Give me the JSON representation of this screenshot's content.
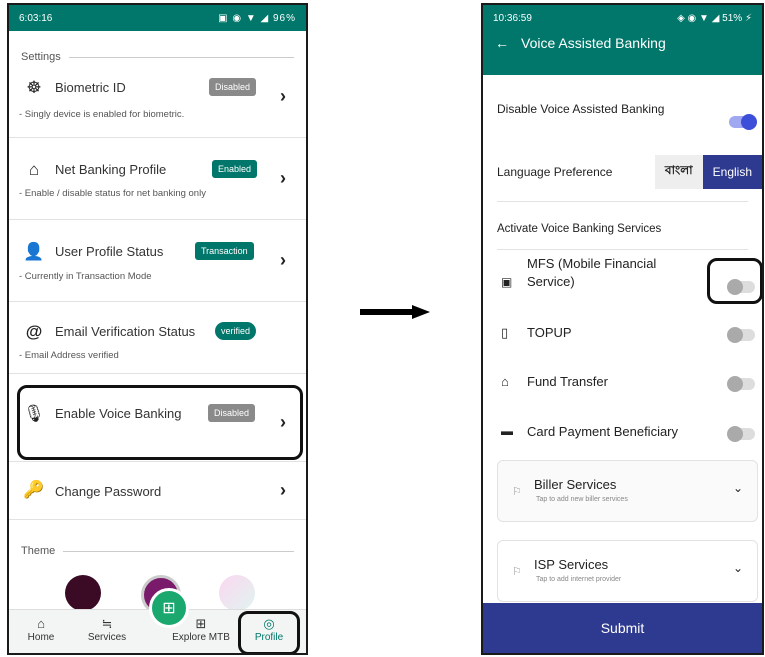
{
  "left_phone": {
    "status_time": "6:03:16",
    "status_icons": "▣ ◉ ▼ ◢ 96%",
    "settings_label": "Settings",
    "items": [
      {
        "title": "Biometric ID",
        "badge": "Disabled",
        "sub": "- Singly device is enabled for biometric."
      },
      {
        "title": "Net Banking Profile",
        "badge": "Enabled",
        "sub": "- Enable / disable status for net banking only"
      },
      {
        "title": "User Profile Status",
        "badge": "Transaction",
        "sub": "- Currently in Transaction Mode"
      },
      {
        "title": "Email Verification Status",
        "badge": "verified",
        "sub": "- Email Address verified"
      },
      {
        "title": "Enable Voice Banking",
        "badge": "Disabled",
        "sub": ""
      },
      {
        "title": "Change Password",
        "badge": "",
        "sub": ""
      }
    ],
    "theme_label": "Theme",
    "nav": [
      "Home",
      "Services",
      "Explore MTB",
      "Profile"
    ]
  },
  "right_phone": {
    "status_time": "10:36:59",
    "status_icons": "◈ ◉ ▼ ◢ 51% ⚡",
    "title": "Voice Assisted Banking",
    "disable_label": "Disable Voice Assisted Banking",
    "lang_label": "Language Preference",
    "lang_bn": "বাংলা",
    "lang_en": "English",
    "activate_label": "Activate Voice Banking Services",
    "services": [
      {
        "name": "MFS (Mobile Financial",
        "name2": "Service)"
      },
      {
        "name": "TOPUP",
        "name2": ""
      },
      {
        "name": "Fund Transfer",
        "name2": ""
      },
      {
        "name": "Card Payment Beneficiary",
        "name2": ""
      }
    ],
    "biller_title": "Biller Services",
    "biller_sub": "Tap to add new biller services",
    "isp_title": "ISP Services",
    "isp_sub": "Tap to add internet provider",
    "submit": "Submit"
  },
  "colors": {
    "accent": "#00776a",
    "submit": "#2e3a8f",
    "toggle_on": "#3b4fd8"
  }
}
